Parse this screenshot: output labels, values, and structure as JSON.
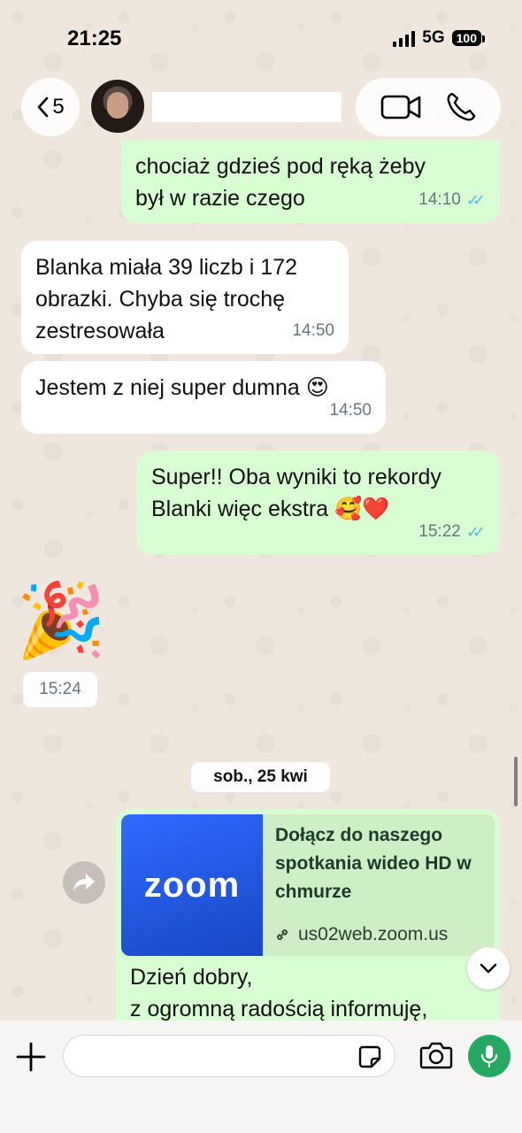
{
  "status_bar": {
    "time": "21:25",
    "network": "5G",
    "battery": "100"
  },
  "header": {
    "back_count": "5",
    "contact_name": ""
  },
  "messages": [
    {
      "line1": "chociaż gdzieś pod ręką żeby",
      "line2": "był w razie czego",
      "time": "14:10"
    },
    {
      "line1": "Blanka miała 39 liczb i 172",
      "line2": "obrazki. Chyba się trochę",
      "line3": "zestresowała",
      "time": "14:50"
    },
    {
      "text": "Jestem z niej super dumna 😍",
      "time": "14:50"
    },
    {
      "line1": "Super!! Oba wyniki to rekordy",
      "line2": "Blanki więc ekstra 🥰❤️",
      "time": "15:22"
    },
    {
      "emoji": "🎉",
      "time": "15:24"
    }
  ],
  "date_separator": "sob., 25 kwi",
  "link_message": {
    "thumb_logo": "zoom",
    "title": "Dołącz do naszego spotkania wideo HD w chmurze",
    "url": "us02web.zoom.us",
    "body_line1": "Dzień dobry,",
    "body_line2": "z ogromną radością informuję,"
  },
  "icons": {
    "back": "chevron-left-icon",
    "video": "video-call-icon",
    "phone": "phone-icon",
    "forward": "forward-icon",
    "link": "link-icon",
    "scroll": "chevron-down-icon",
    "plus": "plus-icon",
    "sticker": "sticker-icon",
    "camera": "camera-icon",
    "mic": "mic-icon"
  },
  "colors": {
    "incoming": "#ffffff",
    "outgoing": "#d9fdd3",
    "read_ticks": "#53bdeb",
    "accent": "#25a861"
  }
}
